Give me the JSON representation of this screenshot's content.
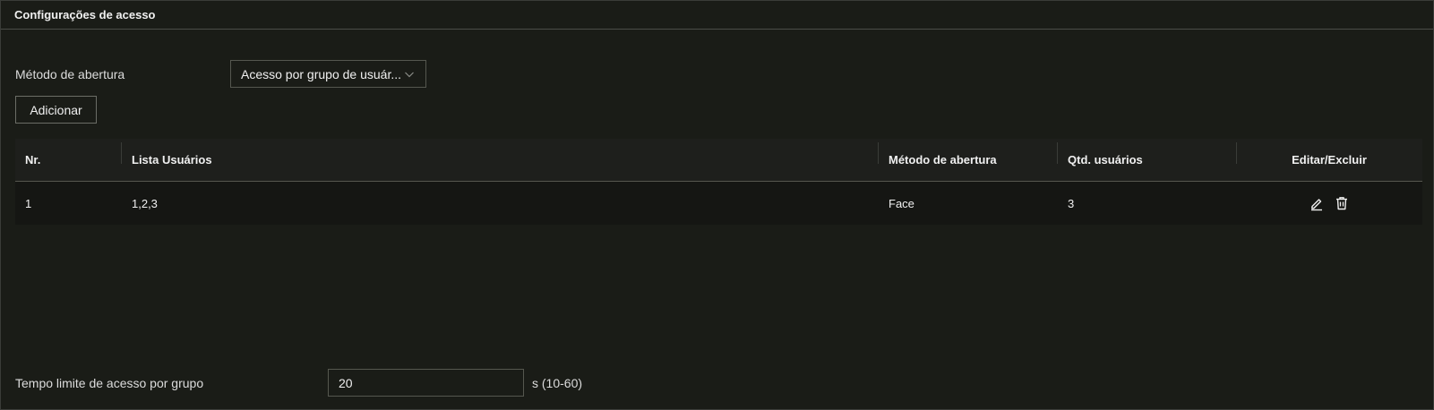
{
  "panel": {
    "title": "Configurações de acesso"
  },
  "method": {
    "label": "Método de abertura",
    "selected": "Acesso por grupo de usuár..."
  },
  "add_button": "Adicionar",
  "table": {
    "headers": {
      "nr": "Nr.",
      "users": "Lista Usuários",
      "method": "Método de abertura",
      "qty": "Qtd. usuários",
      "edit": "Editar/Excluir"
    },
    "rows": [
      {
        "nr": "1",
        "users": "1,2,3",
        "method": "Face",
        "qty": "3"
      }
    ]
  },
  "timeout": {
    "label": "Tempo limite de acesso por grupo",
    "value": "20",
    "unit": "s (10-60)"
  },
  "icons": {
    "edit": "pencil-icon",
    "delete": "trash-icon",
    "dropdown": "chevron-down-icon"
  }
}
